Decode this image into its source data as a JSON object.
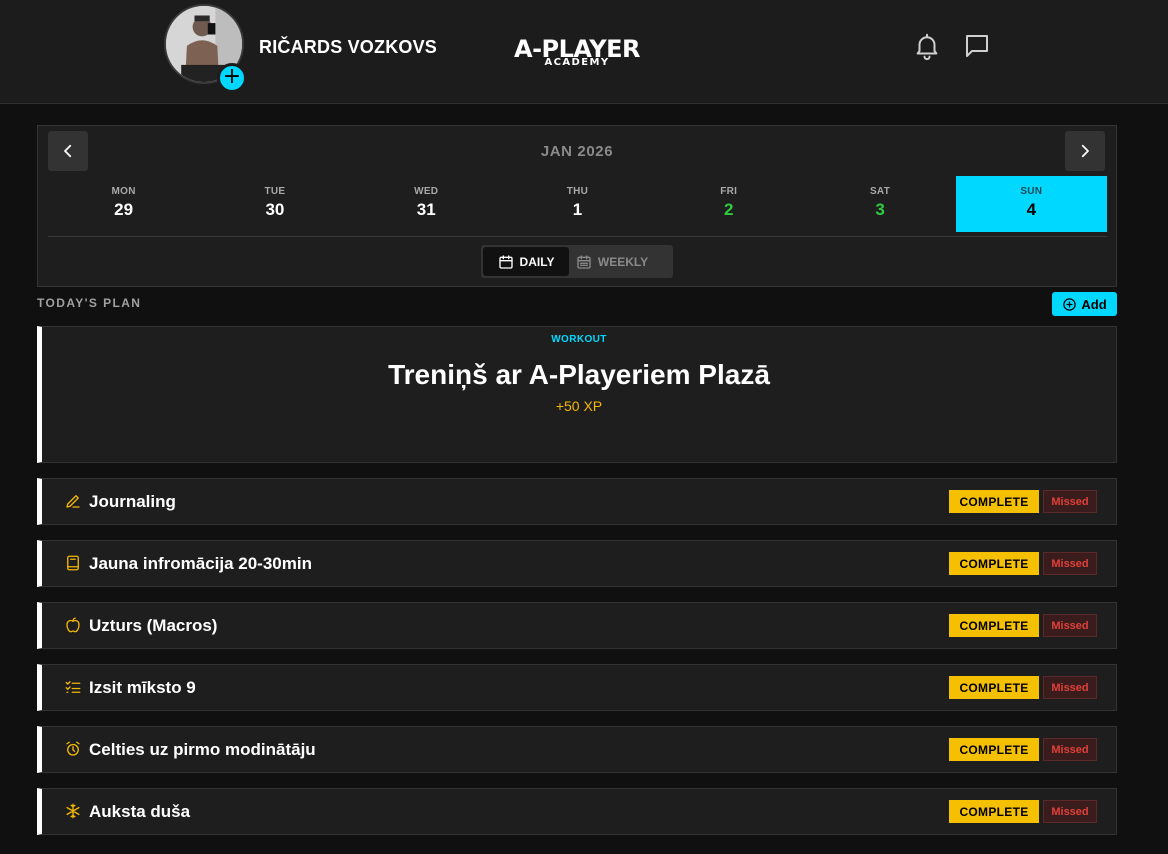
{
  "header": {
    "user_name": "RIČARDS VOZKOVS",
    "avatar_add_symbol": "+",
    "logo_main": "A-PLAYER",
    "logo_sub": "ACADEMY",
    "icons": [
      "bell-icon",
      "chat-icon"
    ]
  },
  "calendar": {
    "month": "JAN 2026",
    "days": [
      {
        "name": "MON",
        "num": "29",
        "state": "normal"
      },
      {
        "name": "TUE",
        "num": "30",
        "state": "normal"
      },
      {
        "name": "WED",
        "num": "31",
        "state": "normal"
      },
      {
        "name": "THU",
        "num": "1",
        "state": "normal"
      },
      {
        "name": "FRI",
        "num": "2",
        "state": "done"
      },
      {
        "name": "SAT",
        "num": "3",
        "state": "done"
      },
      {
        "name": "SUN",
        "num": "4",
        "state": "active"
      }
    ],
    "views": {
      "daily": "DAILY",
      "weekly": "WEEKLY",
      "selected": "daily"
    }
  },
  "plan": {
    "title": "TODAY'S PLAN",
    "add_label": "Add",
    "workout": {
      "label": "WORKOUT",
      "title": "Treniņš ar A-Playeriem Plazā",
      "xp": "+50 XP"
    },
    "tasks": [
      {
        "icon": "pencil-icon",
        "label": "Journaling",
        "complete": "COMPLETE",
        "missed": "Missed"
      },
      {
        "icon": "book-icon",
        "label": "Jauna infromācija 20-30min",
        "complete": "COMPLETE",
        "missed": "Missed"
      },
      {
        "icon": "apple-icon",
        "label": "Uzturs (Macros)",
        "complete": "COMPLETE",
        "missed": "Missed"
      },
      {
        "icon": "checklist-icon",
        "label": "Izsit mīksto 9",
        "complete": "COMPLETE",
        "missed": "Missed"
      },
      {
        "icon": "alarm-clock-icon",
        "label": "Celties uz pirmo modinātāju",
        "complete": "COMPLETE",
        "missed": "Missed"
      },
      {
        "icon": "snowflake-icon",
        "label": "Auksta duša",
        "complete": "COMPLETE",
        "missed": "Missed"
      }
    ]
  },
  "colors": {
    "accent": "#00d8ff",
    "complete": "#f5c000",
    "missed": "#e0413a",
    "done_day": "#2ecc40",
    "xp": "#f2b705"
  }
}
